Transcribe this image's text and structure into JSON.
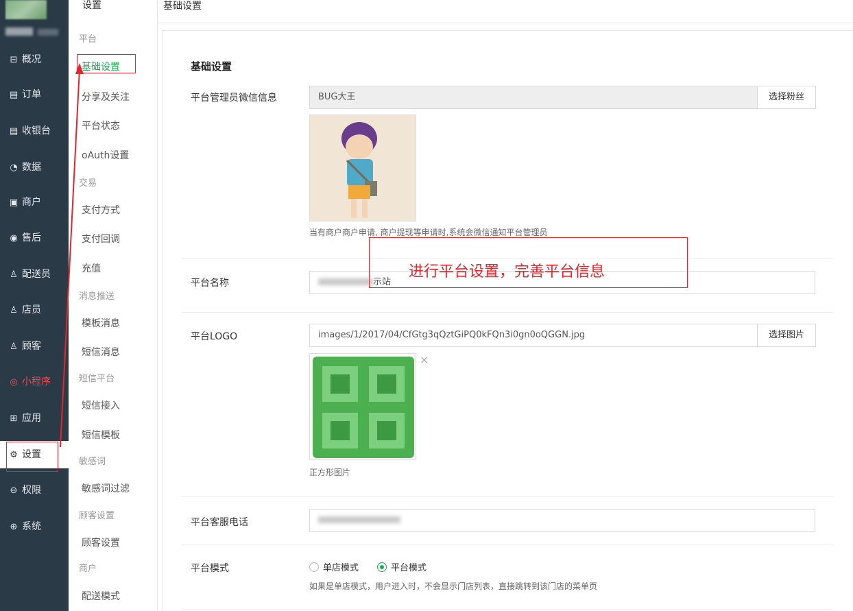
{
  "app": {
    "section_title": "设置",
    "breadcrumb": "基础设置"
  },
  "sidebar": {
    "items": [
      {
        "label": "概况",
        "icon": "overview-icon",
        "glyph": "⊟"
      },
      {
        "label": "订单",
        "icon": "order-icon",
        "glyph": "▤"
      },
      {
        "label": "收银台",
        "icon": "cashier-icon",
        "glyph": "▤"
      },
      {
        "label": "数据",
        "icon": "data-icon",
        "glyph": "◔"
      },
      {
        "label": "商户",
        "icon": "merchant-icon",
        "glyph": "▣"
      },
      {
        "label": "售后",
        "icon": "aftersale-icon",
        "glyph": "◉"
      },
      {
        "label": "配送员",
        "icon": "courier-icon",
        "glyph": "♙"
      },
      {
        "label": "店员",
        "icon": "clerk-icon",
        "glyph": "♙"
      },
      {
        "label": "顾客",
        "icon": "customer-icon",
        "glyph": "♙"
      },
      {
        "label": "小程序",
        "icon": "miniprogram-icon",
        "glyph": "◎"
      },
      {
        "label": "应用",
        "icon": "apps-icon",
        "glyph": "⊞"
      },
      {
        "label": "设置",
        "icon": "gear-icon",
        "glyph": "⚙"
      },
      {
        "label": "权限",
        "icon": "lock-icon",
        "glyph": "⊖"
      },
      {
        "label": "系统",
        "icon": "system-icon",
        "glyph": "⊕"
      }
    ]
  },
  "submenu": {
    "groups": [
      {
        "title": "平台",
        "items": [
          "基础设置",
          "分享及关注",
          "平台状态",
          "oAuth设置"
        ]
      },
      {
        "title": "交易",
        "items": [
          "支付方式",
          "支付回调",
          "充值"
        ]
      },
      {
        "title": "消息推送",
        "items": [
          "模板消息",
          "短信消息"
        ]
      },
      {
        "title": "短信平台",
        "items": [
          "短信接入",
          "短信模板"
        ]
      },
      {
        "title": "敏感词",
        "items": [
          "敏感词过滤"
        ]
      },
      {
        "title": "顾客设置",
        "items": [
          "顾客设置"
        ]
      },
      {
        "title": "商户",
        "items": [
          "配送模式"
        ]
      }
    ]
  },
  "form": {
    "title": "基础设置",
    "admin_label": "平台管理员微信信息",
    "admin_value": "BUG大王",
    "select_fans_button": "选择粉丝",
    "admin_hint": "当有商户商户申请, 商户提现等申请时,系统会微信通知平台管理员",
    "name_label": "平台名称",
    "name_value_suffix": "示站",
    "logo_label": "平台LOGO",
    "logo_value": "images/1/2017/04/CfGtg3qQztGiPQ0kFQn3i0gn0oQGGN.jpg",
    "select_image_button": "选择图片",
    "remove_glyph": "×",
    "logo_hint": "正方形图片",
    "phone_label": "平台客服电话",
    "mode_label": "平台模式",
    "mode_options": [
      "单店模式",
      "平台模式"
    ],
    "mode_selected": "平台模式",
    "mode_hint": "如果是单店模式，用户进入时，不会显示门店列表，直接跳转到该门店的菜单页"
  },
  "annotation": {
    "text": "进行平台设置，完善平台信息"
  },
  "colors": {
    "sidebar_bg": "#2b3a47",
    "accent_green": "#1aad54",
    "annotation_red": "#e5242b",
    "miniprogram_red": "#ff4848"
  }
}
